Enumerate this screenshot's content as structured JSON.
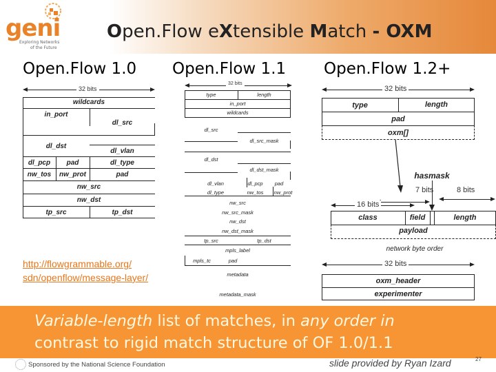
{
  "header": {
    "title_parts": [
      {
        "text": "O",
        "bold": true
      },
      {
        "text": "pen.Flow e",
        "bold": false
      },
      {
        "text": "X",
        "bold": true
      },
      {
        "text": "tensible ",
        "bold": false
      },
      {
        "text": "M",
        "bold": true
      },
      {
        "text": "atch ",
        "bold": false
      },
      {
        "text": "- OXM",
        "bold": true
      }
    ],
    "logo": {
      "wordmark": "geni",
      "tagline_1": "Exploring Networks",
      "tagline_2": "of the Future",
      "brand_color": "#e8832a"
    }
  },
  "versions": {
    "of10": "Open.Flow 1.0",
    "of11": "Open.Flow 1.1",
    "of12": "Open.Flow 1.2+"
  },
  "diagram_of10": {
    "width_label": "32 bits",
    "fields": {
      "wildcards": "wildcards",
      "in_port": "in_port",
      "dl_src": "dl_src",
      "dl_dst": "dl_dst",
      "dl_vlan": "dl_vlan",
      "dl_pcp": "dl_pcp",
      "pad1": "pad",
      "dl_type": "dl_type",
      "nw_tos": "nw_tos",
      "nw_proto": "nw_prot",
      "pad2": "pad",
      "nw_src": "nw_src",
      "nw_dst": "nw_dst",
      "tp_src": "tp_src",
      "tp_dst": "tp_dst"
    }
  },
  "diagram_of11": {
    "width_label": "32 bits",
    "fields": {
      "type": "type",
      "length": "length",
      "in_port": "in_port",
      "wildcards": "wildcards",
      "dl_src": "dl_src",
      "dl_src_mask": "dl_src_mask",
      "dl_dst": "dl_dst",
      "dl_dst_mask": "dl_dst_mask",
      "dl_vlan": "dl_vlan",
      "dl_pcp": "dl_pcp",
      "pad1": "pad",
      "dl_type": "dl_type",
      "nw_tos": "nw_tos",
      "nw_proto": "nw_prot",
      "nw_src": "nw_src",
      "nw_src_mask": "nw_src_mask",
      "nw_dst": "nw_dst",
      "nw_dst_mask": "nw_dst_mask",
      "tp_src": "tp_src",
      "tp_dst": "tp_dst",
      "mpls_label": "mpls_label",
      "mpls_tc": "mpls_tc",
      "pad2": "pad",
      "metadata": "metadata",
      "metadata_mask": "metadata_mask"
    }
  },
  "diagram_of12": {
    "width_label_top": "32 bits",
    "fields_top": {
      "type": "type",
      "length": "length",
      "pad": "pad",
      "oxm": "oxm[]"
    },
    "hasmask_label": "hasmask",
    "bits_7": "7 bits",
    "bits_8": "8 bits",
    "bits_16": "16 bits",
    "oxm_fields": {
      "class": "class",
      "field": "field",
      "length": "length",
      "payload": "payload"
    },
    "byte_order_note": "network byte order",
    "width_label_bottom": "32 bits",
    "experimenter_fields": {
      "oxm_header": "oxm_header",
      "experimenter": "experimenter"
    }
  },
  "source_link": {
    "text": "http://flowgrammable.org/ sdn/openflow/message-layer/",
    "color": "#e8761a"
  },
  "banner": {
    "line1_italic_a": "Variable-length",
    "line1_plain_a": " list of matches, in ",
    "line1_italic_b": "any order in",
    "line2": "contrast to rigid match structure of OF 1.0/1.1",
    "background": "#f79433"
  },
  "footer": {
    "sponsor": "Sponsored by the National Science Foundation",
    "credit": "slide provided by Ryan Izard",
    "page_number": "27"
  }
}
